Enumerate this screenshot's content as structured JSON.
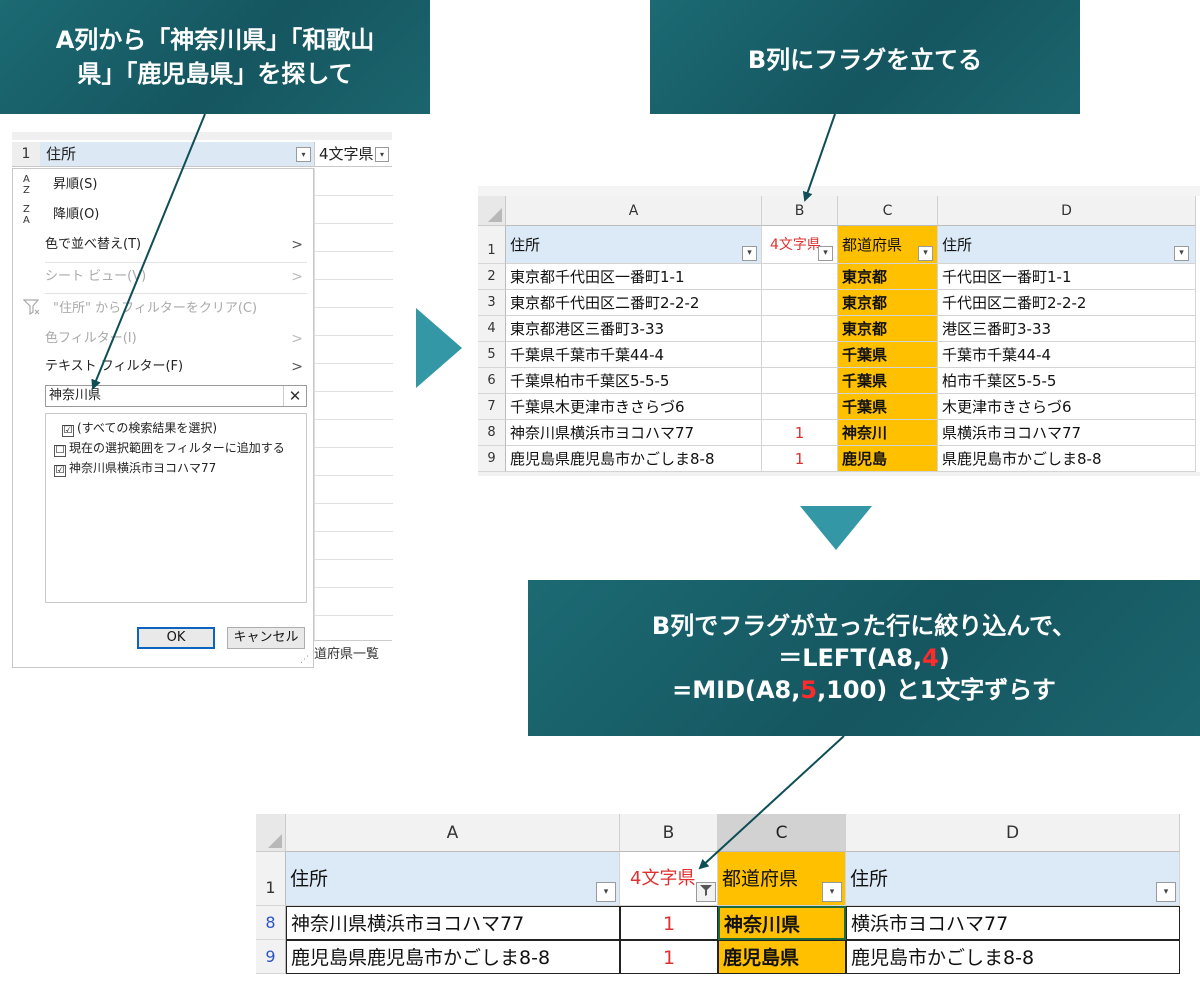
{
  "callouts": {
    "c1": [
      "A列から「神奈川県」「和歌山",
      "県」「鹿児島県」を探して"
    ],
    "c2": "B列にフラグを立てる",
    "c3": {
      "line1": "B列でフラグが立った行に絞り込んで、",
      "line2_pre": "＝LEFT(A8,",
      "line2_red": "4",
      "line2_post": ")",
      "line3_pre": "=MID(A8,",
      "line3_red": "5",
      "line3_post": ",100) と1文字ずらす"
    }
  },
  "filter_panel": {
    "row_num": "1",
    "header_label": "住所",
    "col2_label": "4文字県",
    "dropdown_glyph": "▾",
    "sort_asc": "昇順(S)",
    "sort_desc": "降順(O)",
    "sort_by_color": "色で並べ替え(T)",
    "sheet_view": "シート ビュー(V)",
    "clear_filter": "\"住所\" からフィルターをクリア(C)",
    "color_filter": "色フィルター(I)",
    "text_filter": "テキスト フィルター(F)",
    "search_value": "神奈川県",
    "clear_glyph": "✕",
    "chevron": ">",
    "list_items": [
      "(すべての検索結果を選択)",
      "現在の選択範囲をフィルターに追加する",
      "神奈川県横浜市ヨコハマ77"
    ],
    "list_checked": [
      "☑",
      "☐",
      "☑"
    ],
    "ok": "OK",
    "cancel": "キャンセル",
    "tail_text": "道府県一覧",
    "icon_az": [
      "A",
      "Z"
    ],
    "icon_za": [
      "Z",
      "A"
    ]
  },
  "sheet1": {
    "columns": [
      "A",
      "B",
      "C",
      "D"
    ],
    "headers": {
      "row": "1",
      "a": "住所",
      "b": "4文字県",
      "c": "都道府県",
      "d": "住所"
    },
    "rows": [
      {
        "n": "2",
        "a": "東京都千代田区一番町1-1",
        "b": "",
        "c": "東京都",
        "d": "千代田区一番町1-1"
      },
      {
        "n": "3",
        "a": "東京都千代田区二番町2-2-2",
        "b": "",
        "c": "東京都",
        "d": "千代田区二番町2-2-2"
      },
      {
        "n": "4",
        "a": "東京都港区三番町3-33",
        "b": "",
        "c": "東京都",
        "d": "港区三番町3-33"
      },
      {
        "n": "5",
        "a": "千葉県千葉市千葉44-4",
        "b": "",
        "c": "千葉県",
        "d": "千葉市千葉44-4"
      },
      {
        "n": "6",
        "a": "千葉県柏市千葉区5-5-5",
        "b": "",
        "c": "千葉県",
        "d": "柏市千葉区5-5-5"
      },
      {
        "n": "7",
        "a": "千葉県木更津市きさらづ6",
        "b": "",
        "c": "千葉県",
        "d": "木更津市きさらづ6"
      },
      {
        "n": "8",
        "a": "神奈川県横浜市ヨコハマ77",
        "b": "1",
        "c": "神奈川",
        "d": "県横浜市ヨコハマ77"
      },
      {
        "n": "9",
        "a": "鹿児島県鹿児島市かごしま8-8",
        "b": "1",
        "c": "鹿児島",
        "d": "県鹿児島市かごしま8-8"
      }
    ]
  },
  "sheet2": {
    "columns": [
      "A",
      "B",
      "C",
      "D"
    ],
    "headers": {
      "row": "1",
      "a": "住所",
      "b": "4文字県",
      "c": "都道府県",
      "d": "住所"
    },
    "rows": [
      {
        "n": "8",
        "a": "神奈川県横浜市ヨコハマ77",
        "b": "1",
        "c": "神奈川県",
        "d": "横浜市ヨコハマ77"
      },
      {
        "n": "9",
        "a": "鹿児島県鹿児島市かごしま8-8",
        "b": "1",
        "c": "鹿児島県",
        "d": "鹿児島市かごしま8-8"
      }
    ],
    "filter_glyph": "▾"
  },
  "colors": {
    "callout": "#185f69",
    "arrow": "#3497a6",
    "orange": "#ffc000",
    "header_blue": "#dce9f7",
    "flag_red": "#e03030"
  }
}
